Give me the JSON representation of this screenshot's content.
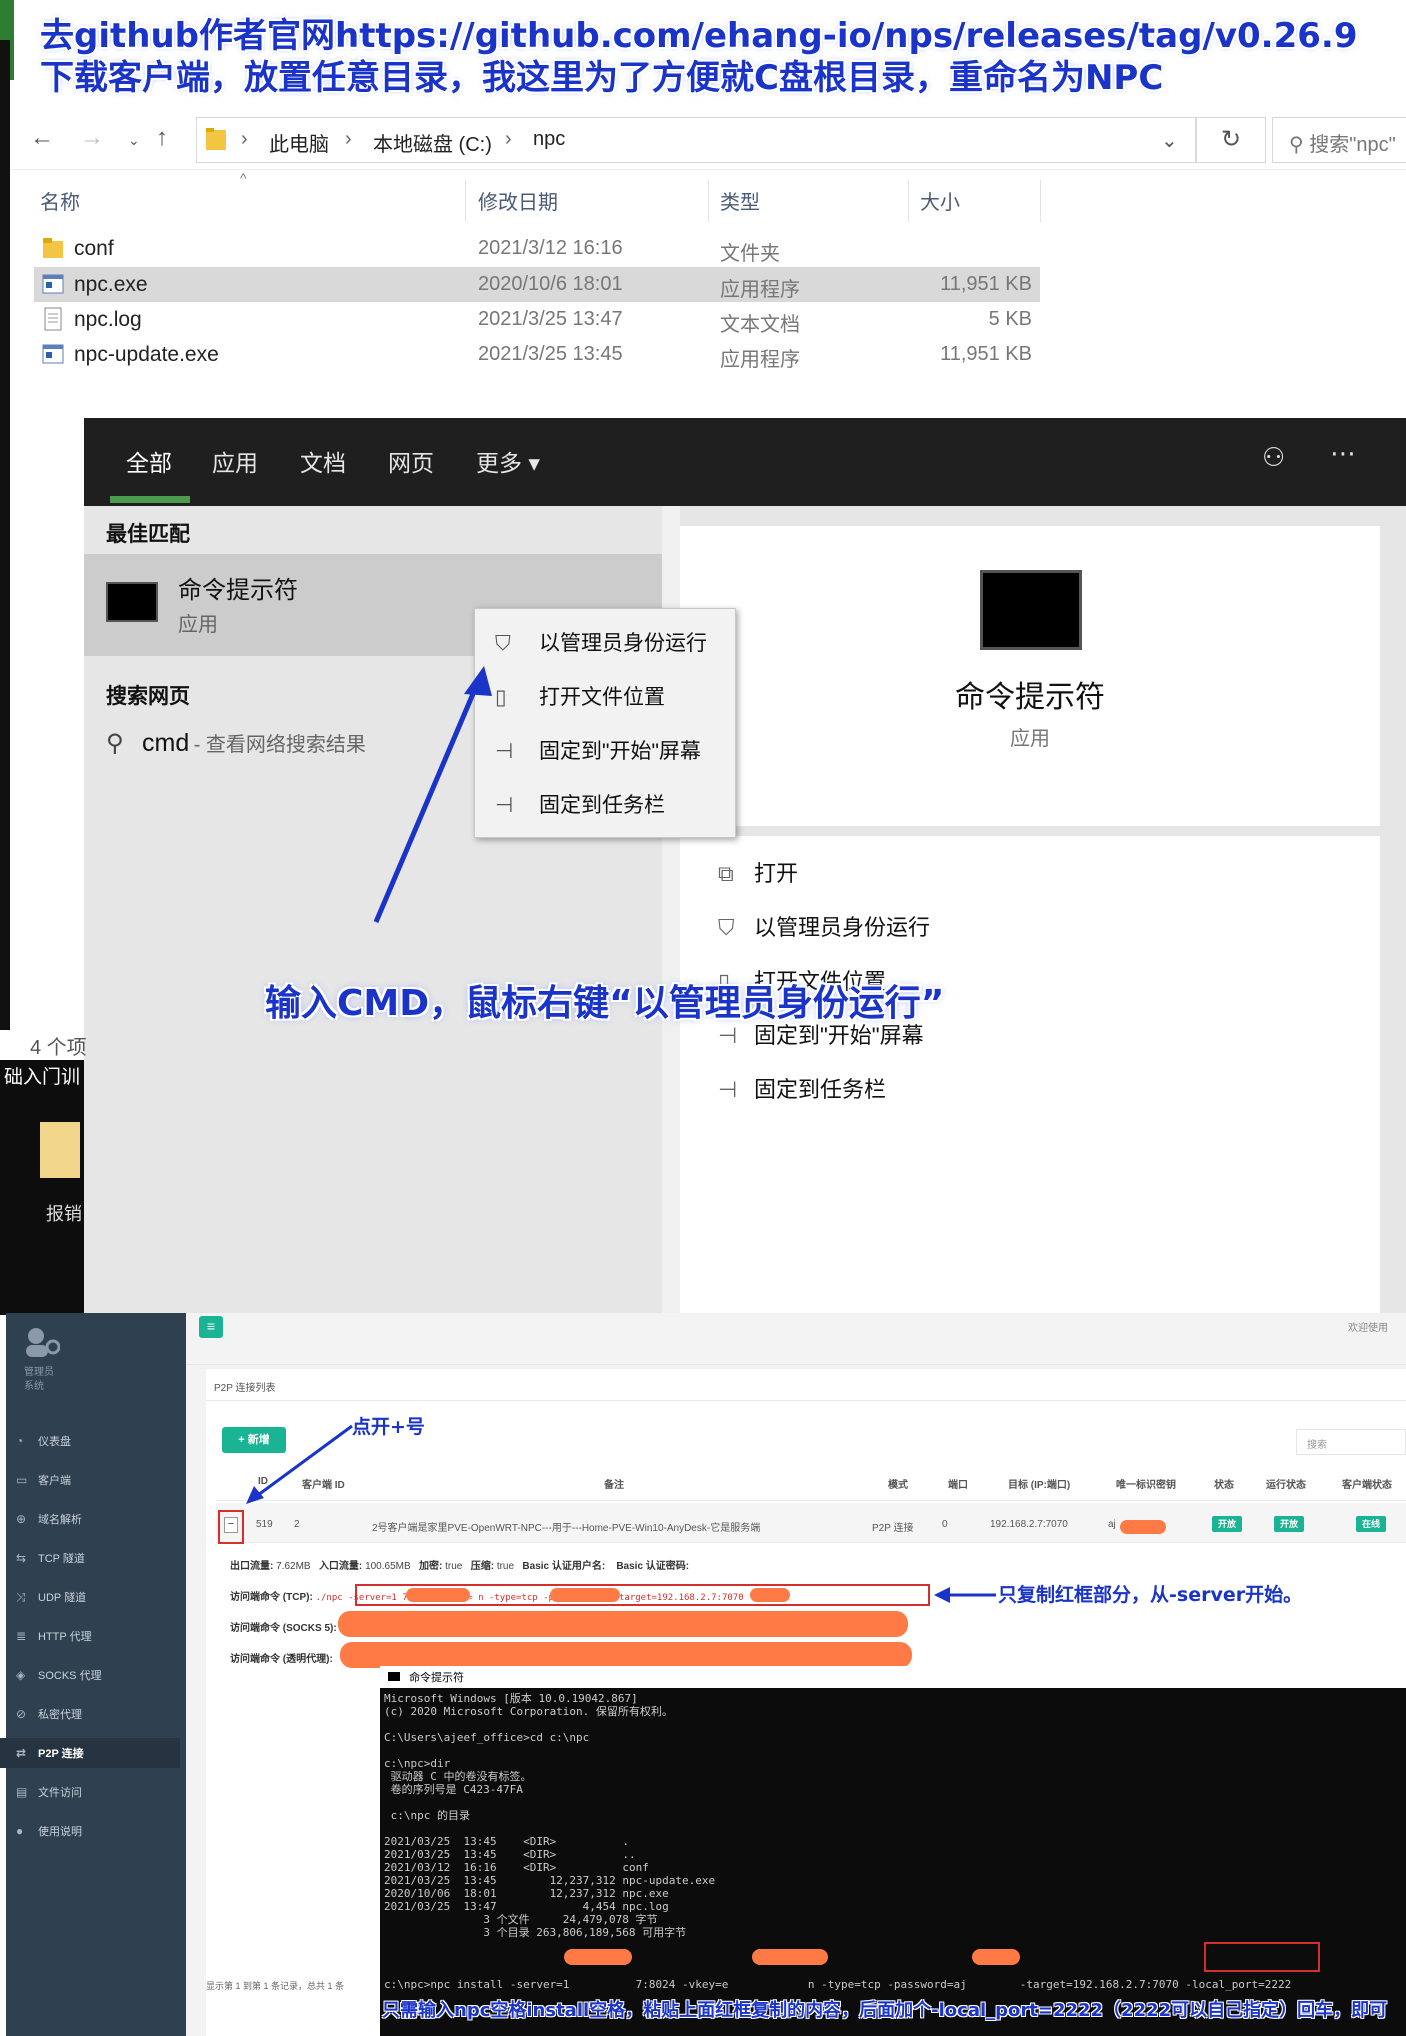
{
  "banner": {
    "line1": "去github作者官网https://github.com/ehang-io/nps/releases/tag/v0.26.9",
    "line2": "下载客户端，放置任意目录，我这里为了方便就C盘根目录，重命名为NPC"
  },
  "explorer": {
    "breadcrumb": [
      "此电脑",
      "本地磁盘 (C:)",
      "npc"
    ],
    "search_placeholder": "搜索\"npc\"",
    "columns": {
      "name": "名称",
      "date": "修改日期",
      "type": "类型",
      "size": "大小"
    },
    "files": [
      {
        "name": "conf",
        "date": "2021/3/12 16:16",
        "type": "文件夹",
        "size": "",
        "icon": "folder-icon"
      },
      {
        "name": "npc.exe",
        "date": "2020/10/6 18:01",
        "type": "应用程序",
        "size": "11,951 KB",
        "icon": "exe-icon"
      },
      {
        "name": "npc.log",
        "date": "2021/3/25 13:47",
        "type": "文本文档",
        "size": "5 KB",
        "icon": "text-file-icon"
      },
      {
        "name": "npc-update.exe",
        "date": "2021/3/25 13:45",
        "type": "应用程序",
        "size": "11,951 KB",
        "icon": "exe-icon"
      }
    ],
    "item_count": "4 个项",
    "left_cutoff": "础入门训",
    "desktop_label": "报销"
  },
  "search_panel": {
    "tabs": [
      "全部",
      "应用",
      "文档",
      "网页",
      "更多 ▾"
    ],
    "best_match_header": "最佳匹配",
    "best_match_title": "命令提示符",
    "best_match_subtitle": "应用",
    "web_header": "搜索网页",
    "web_query": "cmd",
    "web_suffix": " - 查看网络搜索结果",
    "preview_title": "命令提示符",
    "preview_subtitle": "应用",
    "actions": [
      "打开",
      "以管理员身份运行",
      "打开文件位置",
      "固定到\"开始\"屏幕",
      "固定到任务栏"
    ],
    "context_menu": [
      "以管理员身份运行",
      "打开文件位置",
      "固定到\"开始\"屏幕",
      "固定到任务栏"
    ],
    "annotation": "输入CMD，鼠标右键“以管理员身份运行”"
  },
  "admin": {
    "brand": "管理员",
    "brand_sub": "系统",
    "welcome": "欢迎使用",
    "sidebar": [
      "仪表盘",
      "客户端",
      "域名解析",
      "TCP 隧道",
      "UDP 隧道",
      "HTTP 代理",
      "SOCKS 代理",
      "私密代理",
      "P2P 连接",
      "文件访问",
      "使用说明"
    ],
    "panel_title": "P2P 连接列表",
    "add_button": "+ 新增",
    "search_placeholder": "搜索",
    "annotation_plus": "点开+号",
    "columns": [
      "ID",
      "客户端 ID",
      "备注",
      "模式",
      "端口",
      "目标 (IP:端口)",
      "唯一标识密钥",
      "状态",
      "运行状态",
      "客户端状态"
    ],
    "row": {
      "expand": "−",
      "id": "519",
      "client_id": "2",
      "remark": "2号客户端是家里PVE-OpenWRT-NPC---用于---Home-PVE-Win10-AnyDesk-它是服务端",
      "mode": "P2P 连接",
      "port": "0",
      "target": "192.168.2.7:7070",
      "key_prefix": "aj",
      "status": "开放",
      "run_status": "开放",
      "client_status": "在线"
    },
    "detail": {
      "out_label": "出口流量:",
      "out_value": "7.62MB",
      "in_label": "入口流量:",
      "in_value": "100.65MB",
      "enc_label": "加密:",
      "enc_value": "true",
      "comp_label": "压缩:",
      "comp_value": "true",
      "auth_user_label": "Basic 认证用户名:",
      "auth_pass_label": "Basic 认证密码:",
      "cmd_tcp_label": "访问端命令 (TCP):",
      "cmd_tcp_value": "./npc -server=1            7:8024 -vkey=              n -type=tcp -password=aj          -target=192.168.2.7:7070",
      "cmd_socks_label": "访问端命令 (SOCKS 5):",
      "cmd_transparent_label": "访问端命令 (透明代理):"
    },
    "annotation_copy": "只复制红框部分，从-server开始。",
    "footer": "显示第 1 到第 1 条记录，总共 1 条"
  },
  "cmd": {
    "title": "命令提示符",
    "lines": [
      "Microsoft Windows [版本 10.0.19042.867]",
      "(c) 2020 Microsoft Corporation. 保留所有权利。",
      "",
      "C:\\Users\\ajeef_office>cd c:\\npc",
      "",
      "c:\\npc>dir",
      " 驱动器 C 中的卷没有标签。",
      " 卷的序列号是 C423-47FA",
      "",
      " c:\\npc 的目录",
      "",
      "2021/03/25  13:45    <DIR>          .",
      "2021/03/25  13:45    <DIR>          ..",
      "2021/03/12  16:16    <DIR>          conf",
      "2021/03/25  13:45        12,237,312 npc-update.exe",
      "2020/10/06  18:01        12,237,312 npc.exe",
      "2021/03/25  13:47             4,454 npc.log",
      "               3 个文件     24,479,078 字节",
      "               3 个目录 263,806,189,568 可用字节",
      "",
      "",
      "",
      "c:\\npc>npc install -server=1          7:8024 -vkey=e            n -type=tcp -password=aj        -target=192.168.2.7:7070 -local_port=2222"
    ],
    "annotation": "只需输入npc空格install空格，粘贴上面红框复制的内容，后面加个-local_port=2222（2222可以自己指定）回车，即可"
  },
  "colors": {
    "annotation_blue": "#1a33c8",
    "redact_orange": "#ff7a45",
    "highlight_red": "#d32f2f",
    "badge_green": "#1ab394",
    "sidebar_bg": "#2f4050"
  }
}
